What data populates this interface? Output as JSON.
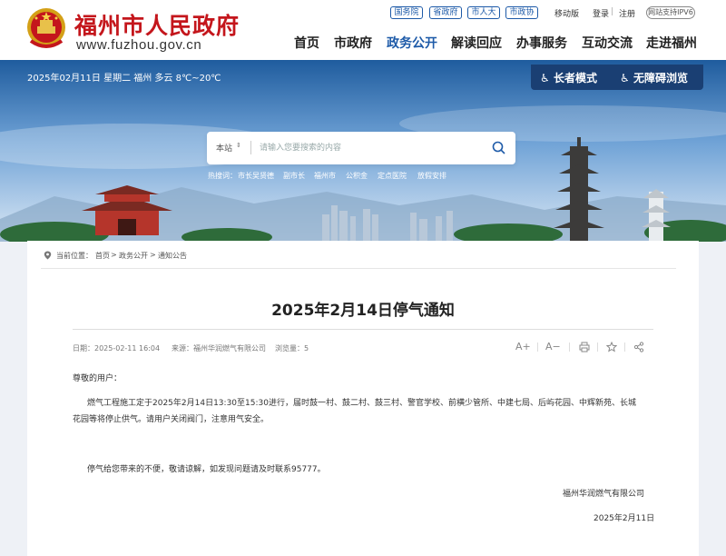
{
  "header": {
    "site_name": "福州市人民政府",
    "site_url": "www.fuzhou.gov.cn",
    "top_pills": [
      "国务院",
      "省政府",
      "市人大",
      "市政协"
    ],
    "mobile": "移动版",
    "login": "登录",
    "register": "注册",
    "ipv6": "网站支持IPV6",
    "nav": [
      "首页",
      "市政府",
      "政务公开",
      "解读回应",
      "办事服务",
      "互动交流",
      "走进福州"
    ],
    "brand_red": "#c4161c",
    "accent_blue": "#1d5aa8"
  },
  "banner": {
    "weather": "2025年02月11日 星期二  福州 多云 8℃~20℃",
    "elder_mode": "长者模式",
    "accessible": "无障碍浏览",
    "search_scope": "本站",
    "search_placeholder": "请输入您要搜索的内容",
    "hot_label": "热搜词：",
    "hot_words": [
      "市长吴贤德",
      "副市长",
      "福州市",
      "公积金",
      "定点医院",
      "放假安排"
    ]
  },
  "breadcrumb": {
    "label": "当前位置：",
    "items": [
      "首页",
      "政务公开",
      "通知公告"
    ]
  },
  "article": {
    "title": "2025年2月14日停气通知",
    "date": "日期：2025-02-11 16:04",
    "source": "来源：福州华润燃气有限公司",
    "views": "浏览量：5",
    "tools": {
      "font_up": "A+",
      "font_down": "A−"
    },
    "greeting": "尊敬的用户：",
    "body1_line1": "燃气工程施工定于2025年2月14日13:30至15:30进行，届时鼓一村、鼓二村、鼓三村、警官学校、前横少管所、中建七局、后屿花园、中辉新苑、长城",
    "body1_line2": "花园等将停止供气。请用户关闭阀门，注意用气安全。",
    "body2": "停气给您带来的不便，敬请谅解，如发现问题请及时联系95777。",
    "signature": "福州华润燃气有限公司",
    "sign_date": "2025年2月11日"
  }
}
